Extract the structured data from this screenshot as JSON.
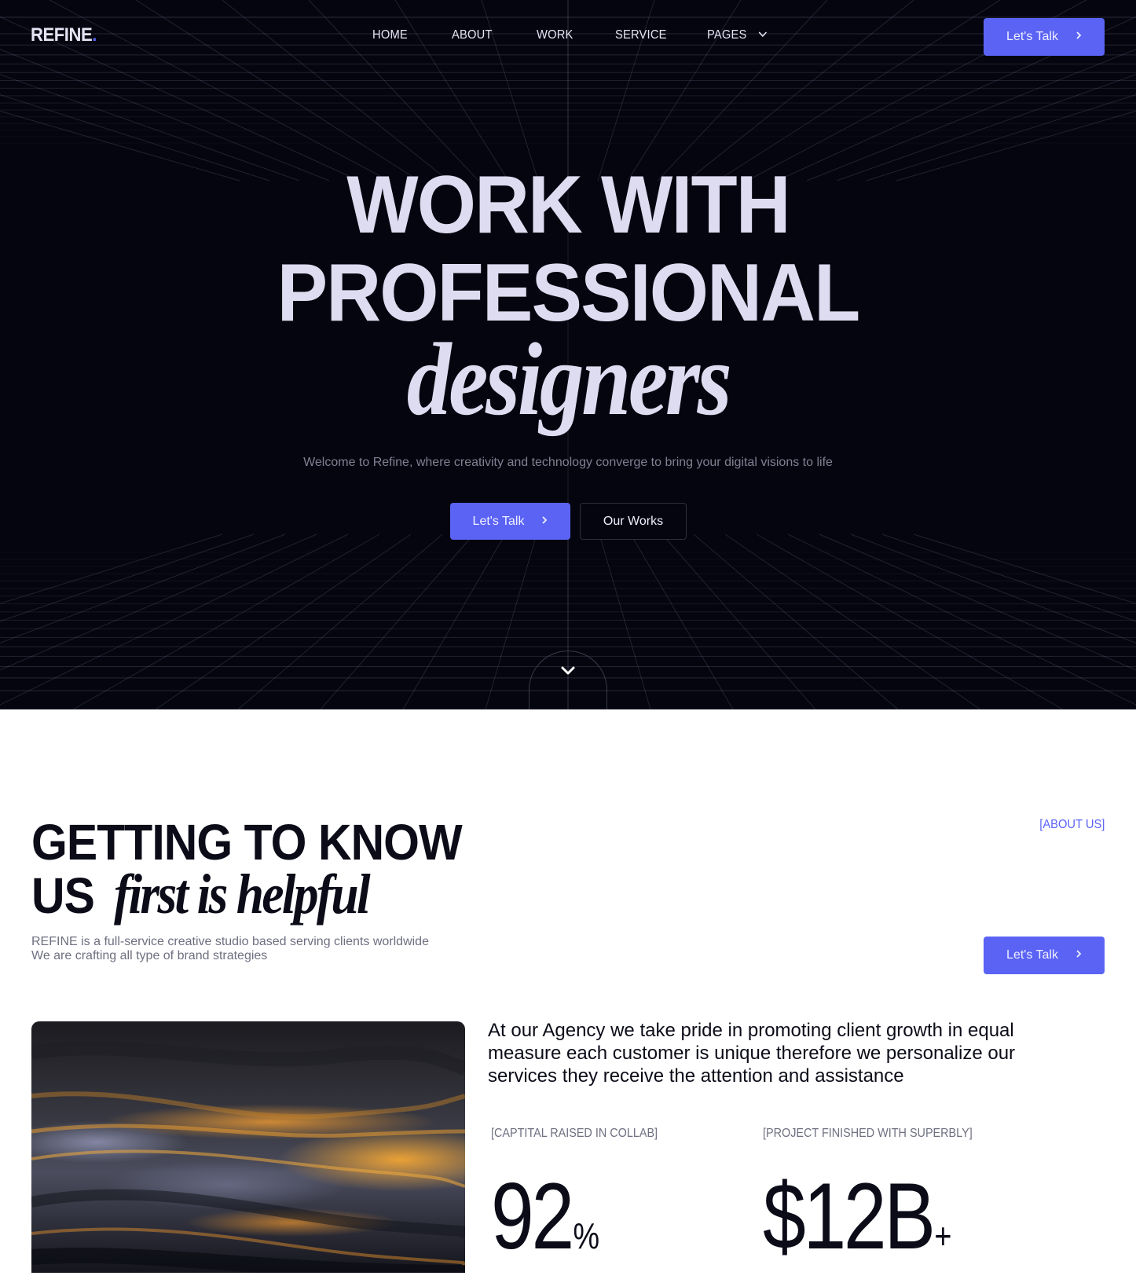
{
  "brand": {
    "name": "REFINE",
    "dot": ".",
    "accent_color": "#5b63f5"
  },
  "nav": {
    "items": [
      {
        "label": "HOME"
      },
      {
        "label": "ABOUT"
      },
      {
        "label": "WORK"
      },
      {
        "label": "SERVICE"
      },
      {
        "label": "PAGES",
        "has_dropdown": true
      }
    ],
    "cta_label": "Let's Talk",
    "cta_icon": "chevron-right-icon"
  },
  "hero": {
    "title_line1": "WORK WITH",
    "title_line2": "PROFESSIONAL",
    "title_line3": "designers",
    "subtitle": "Welcome to Refine, where creativity and technology converge to bring your digital visions to life",
    "primary_button": "Let's Talk",
    "secondary_button": "Our Works",
    "scroll_icon": "chevron-down-icon",
    "background_color": "#05050f"
  },
  "about": {
    "title_line1": "GETTING TO KNOW",
    "title_line2_plain": "US",
    "title_line2_italic": "first is helpful",
    "description_line1": "REFINE is a full-service creative studio based serving clients worldwide",
    "description_line2": "We are crafting all type of brand strategies",
    "tag": "[ABOUT US]",
    "cta_label": "Let's Talk",
    "paragraph": "At our Agency we take pride in promoting client growth in equal measure each customer is unique therefore we personalize our services they receive the attention and assistance",
    "image_alt": "abstract dark and golden flowing waves",
    "stats": [
      {
        "label": "[CAPTITAL RAISED IN COLLAB]",
        "value": "92",
        "suffix": "%"
      },
      {
        "label": "[PROJECT FINISHED WITH SUPERBLY]",
        "value": "$12B",
        "suffix": "+"
      }
    ]
  }
}
